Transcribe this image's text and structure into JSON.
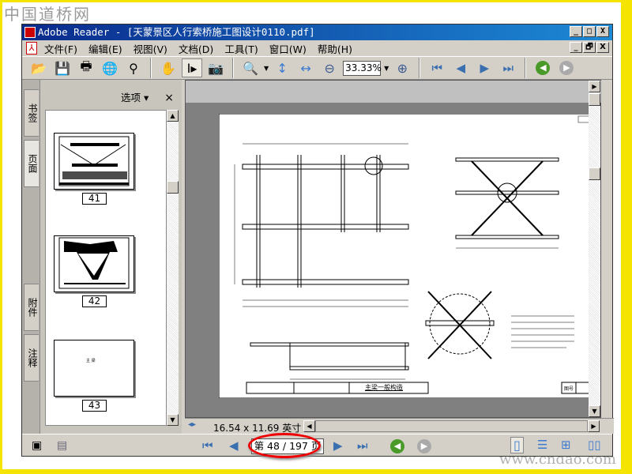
{
  "watermark": {
    "top": "中国道桥网",
    "bottom": "www.cndao.com"
  },
  "window": {
    "title": "Adobe Reader - [天蒙景区人行索桥施工图设计0110.pdf]",
    "min": "_",
    "max": "□",
    "close": "X",
    "restore": "🗗"
  },
  "menu": [
    "文件(F)",
    "编辑(E)",
    "视图(V)",
    "文档(D)",
    "工具(T)",
    "窗口(W)",
    "帮助(H)"
  ],
  "toolbar": {
    "zoom_value": "33.33%"
  },
  "side_tabs": [
    "书签",
    "页面",
    "附件",
    "注释"
  ],
  "panel": {
    "options_label": "选项 ▾",
    "close": "×",
    "thumbnails": [
      {
        "label": "41"
      },
      {
        "label": "42"
      },
      {
        "label": "43",
        "text": "主 梁"
      }
    ]
  },
  "document": {
    "page_size": "16.54 x 11.69 英寸",
    "title_block": {
      "drawing_title": "主梁一般构造",
      "drawing_no_label": "图号"
    }
  },
  "status": {
    "page_indicator": "第 48 / 197 页",
    "current_page": 48,
    "total_pages": 197
  },
  "colors": {
    "highlight_ellipse": "#e00000",
    "frame": "#f5e400",
    "titlebar": "#0a2a8c"
  }
}
